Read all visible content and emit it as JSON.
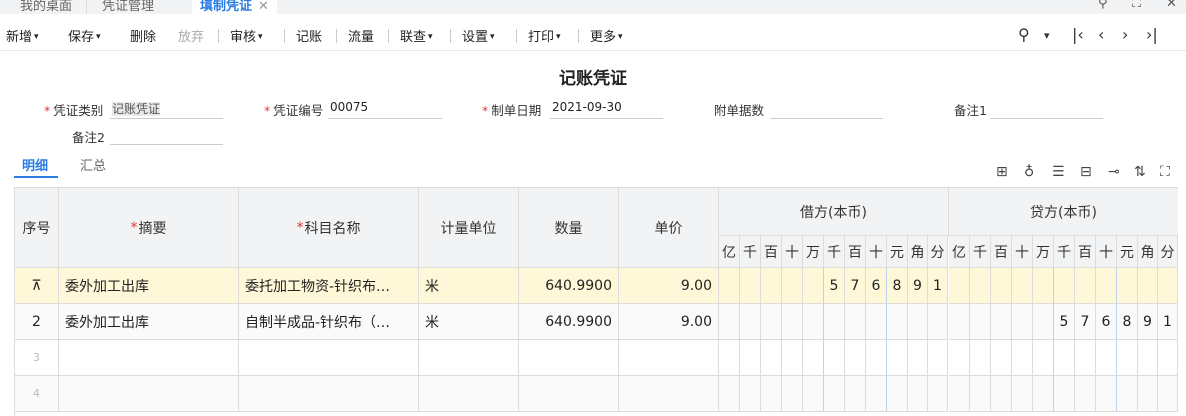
{
  "tabs": [
    {
      "label": "我的桌面"
    },
    {
      "label": "凭证管理"
    },
    {
      "label": "填制凭证",
      "active": true
    }
  ],
  "toolbar": {
    "add": "新增",
    "save": "保存",
    "delete": "删除",
    "discard": "放弃",
    "review": "审核",
    "post": "记账",
    "flow": "流量",
    "query": "联查",
    "settings": "设置",
    "print": "打印",
    "more": "更多"
  },
  "voucher": {
    "title": "记账凭证",
    "type_label": "凭证类别",
    "type_value": "记账凭证",
    "number_label": "凭证编号",
    "number_value": "00075",
    "date_label": "制单日期",
    "date_value": "2021-09-30",
    "attachments_label": "附单据数",
    "attachments_value": "",
    "note1_label": "备注1",
    "note1_value": "",
    "note2_label": "备注2",
    "note2_value": ""
  },
  "subtabs": [
    "明细",
    "汇总"
  ],
  "table": {
    "headers": {
      "seq": "序号",
      "summary": "摘要",
      "account": "科目名称",
      "unit": "计量单位",
      "qty": "数量",
      "price": "单价",
      "debit": "借方(本币)",
      "credit": "贷方(本币)"
    },
    "digits": [
      "亿",
      "千",
      "百",
      "十",
      "万",
      "千",
      "百",
      "十",
      "元",
      "角",
      "分"
    ],
    "rows": [
      {
        "seq": "",
        "summary": "委外加工出库",
        "account": "委托加工物资-针织布…",
        "unit": "米",
        "qty": "640.9900",
        "price": "9.00",
        "debit_digits": [
          "",
          "",
          "",
          "",
          "",
          "5",
          "7",
          "6",
          "8",
          "9",
          "1"
        ],
        "credit_digits": [
          "",
          "",
          "",
          "",
          "",
          "",
          "",
          "",
          "",
          "",
          ""
        ]
      },
      {
        "seq": "2",
        "summary": "委外加工出库",
        "account": "自制半成品-针织布（…",
        "unit": "米",
        "qty": "640.9900",
        "price": "9.00",
        "debit_digits": [
          "",
          "",
          "",
          "",
          "",
          "",
          "",
          "",
          "",
          "",
          ""
        ],
        "credit_digits": [
          "",
          "",
          "",
          "",
          "",
          "5",
          "7",
          "6",
          "8",
          "9",
          "1"
        ]
      },
      {
        "seq": "3"
      },
      {
        "seq": "4"
      }
    ]
  }
}
